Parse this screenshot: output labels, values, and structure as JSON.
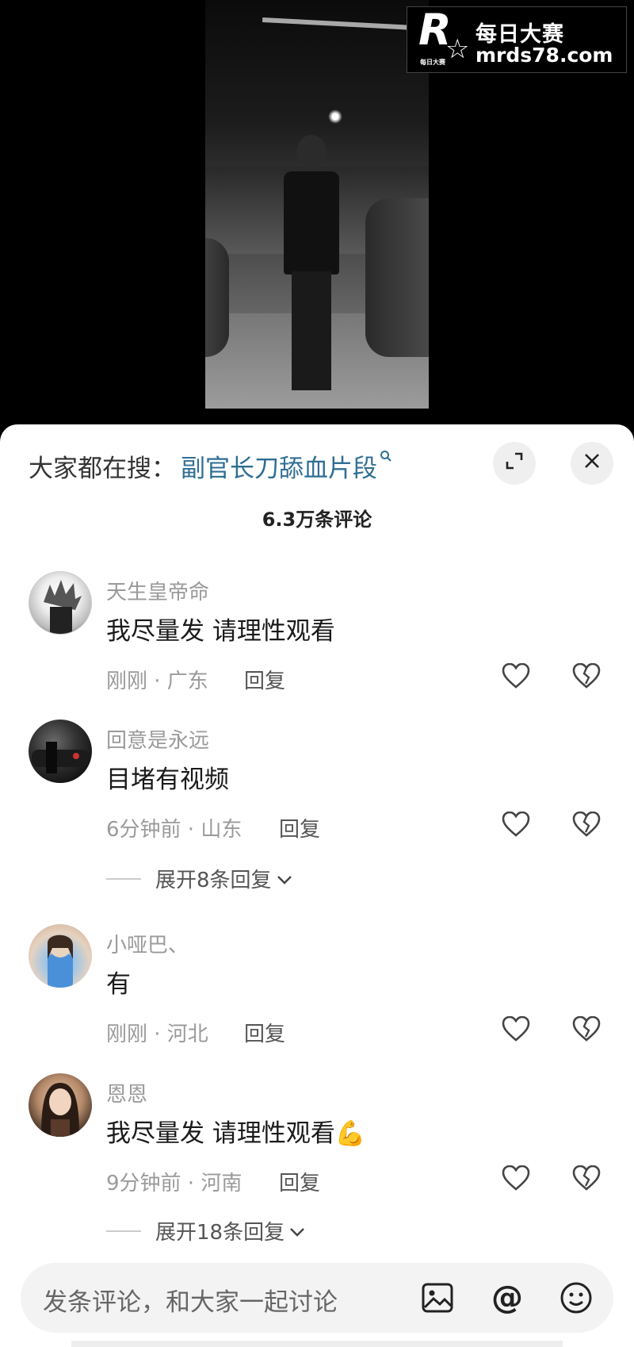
{
  "watermark": {
    "title": "每日大赛",
    "url": "mrds78.com",
    "logo_letter": "R",
    "logo_small": "每日大赛"
  },
  "sheet": {
    "search_label": "大家都在搜：",
    "search_term": "副官长刀舔血片段",
    "comment_count": "6.3万条评论"
  },
  "comments": [
    {
      "username": "天生皇帝命",
      "text": "我尽量发 请理性观看",
      "meta": "刚刚 · 广东",
      "reply": "回复",
      "avatar": "anime-avatar"
    },
    {
      "username": "回意是永远",
      "text": "目堵有视频",
      "meta": "6分钟前 · 山东",
      "reply": "回复",
      "avatar": "car-avatar",
      "expand": "展开8条回复"
    },
    {
      "username": "小哑巴、",
      "text": "有",
      "meta": "刚刚 · 河北",
      "reply": "回复",
      "avatar": "girl-avatar"
    },
    {
      "username": "恩恩",
      "text": "我尽量发  请理性观看",
      "emoji": "💪",
      "meta": "9分钟前 · 河南",
      "reply": "回复",
      "avatar": "woman-avatar",
      "expand": "展开18条回复"
    }
  ],
  "input": {
    "placeholder": "发条评论，和大家一起讨论",
    "at_symbol": "@"
  },
  "icons": {
    "search": "search-icon",
    "expand": "expand-icon",
    "close": "close-icon",
    "like": "heart-icon",
    "dislike": "broken-heart-icon",
    "image": "image-icon",
    "emoji": "emoji-icon"
  },
  "colors": {
    "link": "#2f6e93",
    "muted": "#9a9a9a",
    "text": "#1a1a1a",
    "background": "#ffffff"
  }
}
